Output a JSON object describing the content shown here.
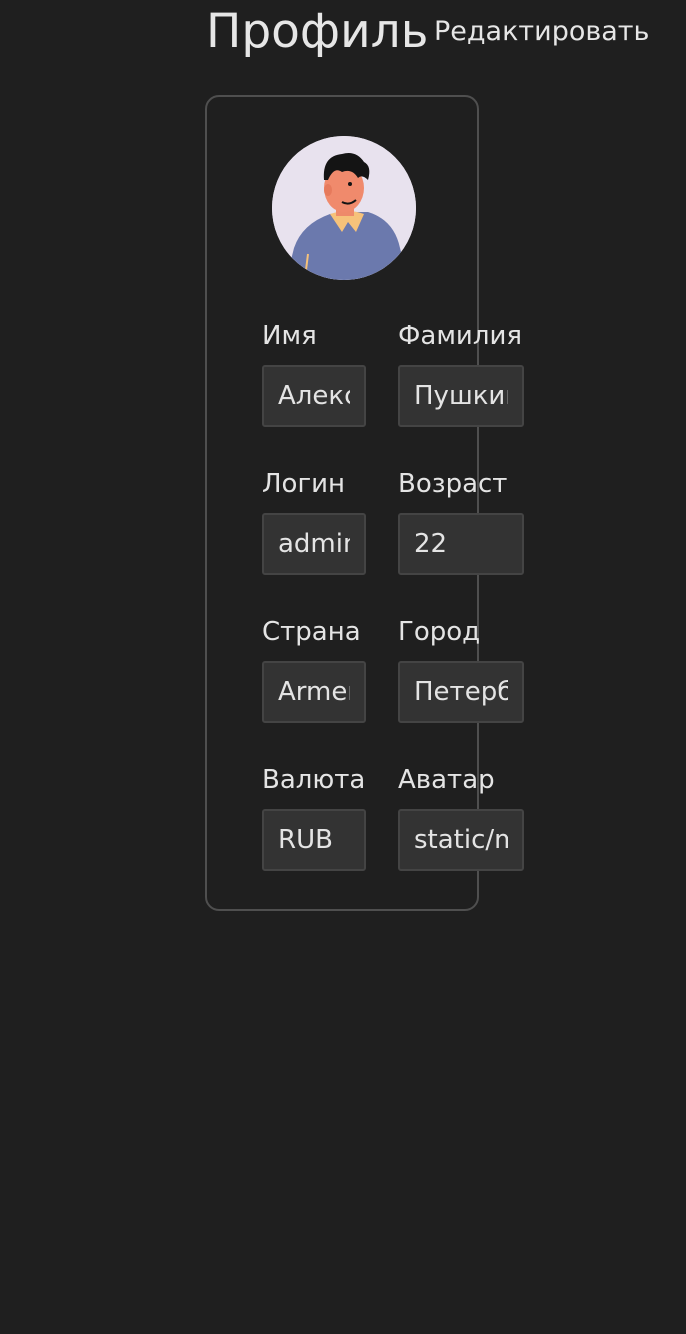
{
  "header": {
    "title": "Профиль",
    "edit_label": "Редактировать"
  },
  "avatar": {
    "icon": "user-avatar-illustration"
  },
  "fields": {
    "first_name": {
      "label": "Имя",
      "value": "Алексей"
    },
    "last_name": {
      "label": "Фамилия",
      "value": "Пушкин"
    },
    "username": {
      "label": "Логин",
      "value": "admin"
    },
    "age": {
      "label": "Возраст",
      "value": "22"
    },
    "country": {
      "label": "Страна",
      "value": "Armenia"
    },
    "city": {
      "label": "Город",
      "value": "Петербург"
    },
    "currency": {
      "label": "Валюта",
      "value": "RUB"
    },
    "avatar_url": {
      "label": "Аватар",
      "value": "static/media/avatar.png"
    }
  },
  "colors": {
    "background": "#1f1f1f",
    "card_border": "#4f4f4f",
    "input_bg": "#333333",
    "text": "#e4e4e4"
  }
}
